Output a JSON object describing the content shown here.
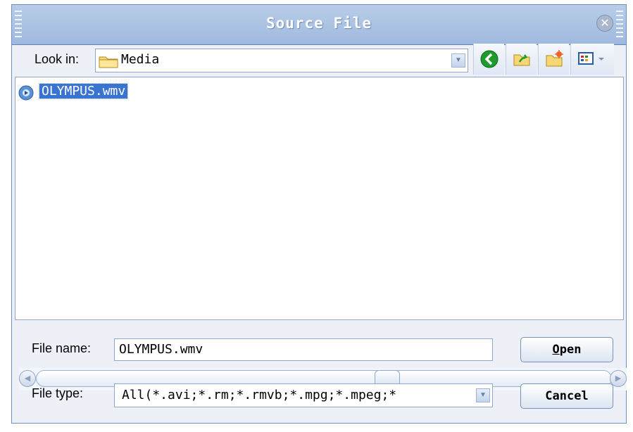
{
  "dialog": {
    "title": "Source File",
    "close_glyph": "✕"
  },
  "lookin": {
    "label": "Look in:",
    "value": "Media",
    "icon": "folder-icon"
  },
  "toolbar": {
    "buttons": [
      "back-icon",
      "up-folder-icon",
      "new-folder-icon",
      "view-menu-icon"
    ]
  },
  "files": [
    {
      "name": "OLYMPUS.wmv",
      "icon": "media-file-icon",
      "selected": true
    }
  ],
  "scrollbar": {
    "left_arrow": "◀",
    "right_arrow": "▶",
    "position": 0.6
  },
  "filename": {
    "label": "File name:",
    "value": "OLYMPUS.wmv"
  },
  "filetype": {
    "label": "File type:",
    "value": "All(*.avi;*.rm;*.rmvb;*.mpg;*.mpeg;*"
  },
  "buttons": {
    "open_first": "O",
    "open_rest": "pen",
    "cancel": "Cancel"
  },
  "colors": {
    "titlebar": "#b9cde9",
    "selection": "#3a74d3",
    "border": "#8fa7cb"
  }
}
